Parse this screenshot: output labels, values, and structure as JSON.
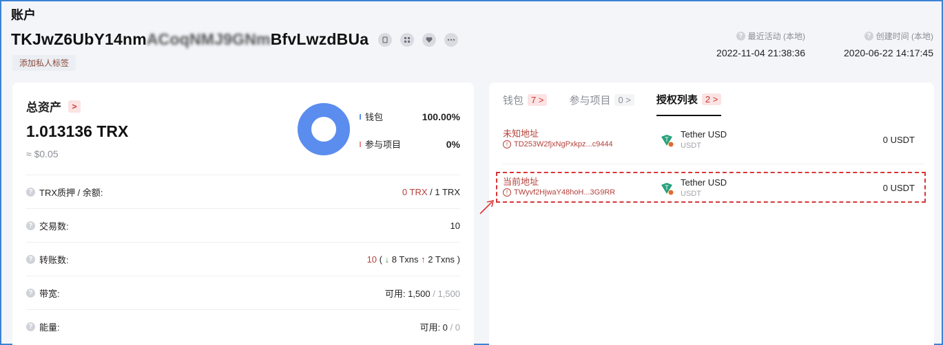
{
  "header": {
    "title": "账户",
    "address_start": "TKJwZ6UbY14nm",
    "address_blur": "ACoqNMJ9GNm",
    "address_end": "BfvLwzdBUa",
    "add_tag": "添加私人标签",
    "last_active_label": "最近活动 (本地)",
    "last_active_value": "2022-11-04 21:38:36",
    "created_label": "创建时间 (本地)",
    "created_value": "2020-06-22 14:17:45",
    "icons": [
      "copy-icon",
      "qrcode-icon",
      "heart-icon",
      "more-icon"
    ]
  },
  "assets": {
    "title": "总资产",
    "total": "1.013136 TRX",
    "usd": "≈ $0.05",
    "legend": [
      {
        "name": "钱包",
        "pct": "100.00%",
        "color": "#5b8def"
      },
      {
        "name": "参与项目",
        "pct": "0%",
        "color": "#e88a8a"
      }
    ]
  },
  "chart_data": {
    "type": "pie",
    "categories": [
      "钱包",
      "参与项目"
    ],
    "values": [
      100,
      0
    ]
  },
  "stats": {
    "stake_label": "TRX质押 / 余额:",
    "stake_value": "0 TRX",
    "balance_value": "/ 1 TRX",
    "txn_label": "交易数:",
    "txn_value": "10",
    "transfer_label": "转账数:",
    "transfer_value": "10",
    "transfer_in": "8 Txns",
    "transfer_out": "2 Txns",
    "bandwidth_label": "带宽:",
    "bandwidth_value": "可用: 1,500",
    "bandwidth_total": "/ 1,500",
    "energy_label": "能量:",
    "energy_value": "可用: 0",
    "energy_total": "/ 0"
  },
  "tabs": [
    {
      "label": "钱包",
      "count": "7 >"
    },
    {
      "label": "参与项目",
      "count": "0 >"
    },
    {
      "label": "授权列表",
      "count": "2 >"
    }
  ],
  "approvals": [
    {
      "type": "未知地址",
      "address": "TD253W2fjxNgPxkpz...c9444",
      "token": "Tether USD",
      "symbol": "USDT",
      "amount": "0  USDT"
    },
    {
      "type": "当前地址",
      "address": "TWyvf2HjwaY48hoH...3G9RR",
      "token": "Tether USD",
      "symbol": "USDT",
      "amount": "0  USDT"
    }
  ],
  "colors": {
    "accent_red": "#b3413a",
    "donut_blue": "#5b8def",
    "highlight": "#d93434"
  }
}
